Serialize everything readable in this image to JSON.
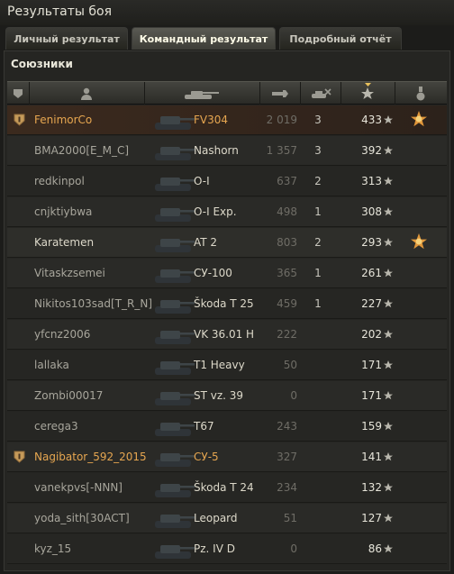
{
  "window": {
    "title": "Результаты боя"
  },
  "tabs": [
    {
      "label": "Личный результат",
      "active": false
    },
    {
      "label": "Командный результат",
      "active": true
    },
    {
      "label": "Подробный отчёт",
      "active": false
    }
  ],
  "section": {
    "title": "Союзники"
  },
  "columns": [
    "platoon-icon",
    "player-icon",
    "tank-icon",
    "damage-icon",
    "frags-icon",
    "xp-star-icon",
    "medal-icon"
  ],
  "colors": {
    "accent_gold": "#e6a650",
    "player_row": "#3b2a1e"
  },
  "rows": [
    {
      "name": "FenimorCo",
      "vehicle": "FV304",
      "damage": "2 019",
      "frags": "3",
      "xp": "433",
      "platoon": true,
      "medal": true,
      "highlight": "player"
    },
    {
      "name": "BMA2000[E_M_C]",
      "vehicle": "Nashorn",
      "damage": "1 357",
      "frags": "3",
      "xp": "392",
      "platoon": false,
      "medal": false
    },
    {
      "name": "redkinpol",
      "vehicle": "O-I",
      "damage": "637",
      "frags": "2",
      "xp": "313",
      "platoon": false,
      "medal": false
    },
    {
      "name": "cnjktiybwa",
      "vehicle": "O-I Exp.",
      "damage": "498",
      "frags": "1",
      "xp": "308",
      "platoon": false,
      "medal": false
    },
    {
      "name": "Karatemen",
      "vehicle": "AT 2",
      "damage": "803",
      "frags": "2",
      "xp": "293",
      "platoon": false,
      "medal": true,
      "highlight": "self"
    },
    {
      "name": "Vitaskzsemei",
      "vehicle": "СУ-100",
      "damage": "365",
      "frags": "1",
      "xp": "261",
      "platoon": false,
      "medal": false
    },
    {
      "name": "Nikitos103sad[T_R_N]",
      "vehicle": "Škoda T 25",
      "damage": "459",
      "frags": "1",
      "xp": "227",
      "platoon": false,
      "medal": false
    },
    {
      "name": "yfcnz2006",
      "vehicle": "VK 36.01 H",
      "damage": "222",
      "frags": "",
      "xp": "202",
      "platoon": false,
      "medal": false
    },
    {
      "name": "lallaka",
      "vehicle": "T1 Heavy",
      "damage": "50",
      "frags": "",
      "xp": "171",
      "platoon": false,
      "medal": false
    },
    {
      "name": "Zombi00017",
      "vehicle": "ST vz. 39",
      "damage": "0",
      "frags": "",
      "xp": "171",
      "platoon": false,
      "medal": false
    },
    {
      "name": "cerega3",
      "vehicle": "T67",
      "damage": "243",
      "frags": "",
      "xp": "159",
      "platoon": false,
      "medal": false
    },
    {
      "name": "Nagibator_592_2015",
      "vehicle": "СУ-5",
      "damage": "327",
      "frags": "",
      "xp": "141",
      "platoon": true,
      "medal": false,
      "gold": true
    },
    {
      "name": "vanekpvs[-NNN]",
      "vehicle": "Škoda T 24",
      "damage": "234",
      "frags": "",
      "xp": "132",
      "platoon": false,
      "medal": false
    },
    {
      "name": "yoda_sith[30ACT]",
      "vehicle": "Leopard",
      "damage": "51",
      "frags": "",
      "xp": "127",
      "platoon": false,
      "medal": false
    },
    {
      "name": "kyz_15",
      "vehicle": "Pz. IV D",
      "damage": "0",
      "frags": "",
      "xp": "86",
      "platoon": false,
      "medal": false
    }
  ]
}
